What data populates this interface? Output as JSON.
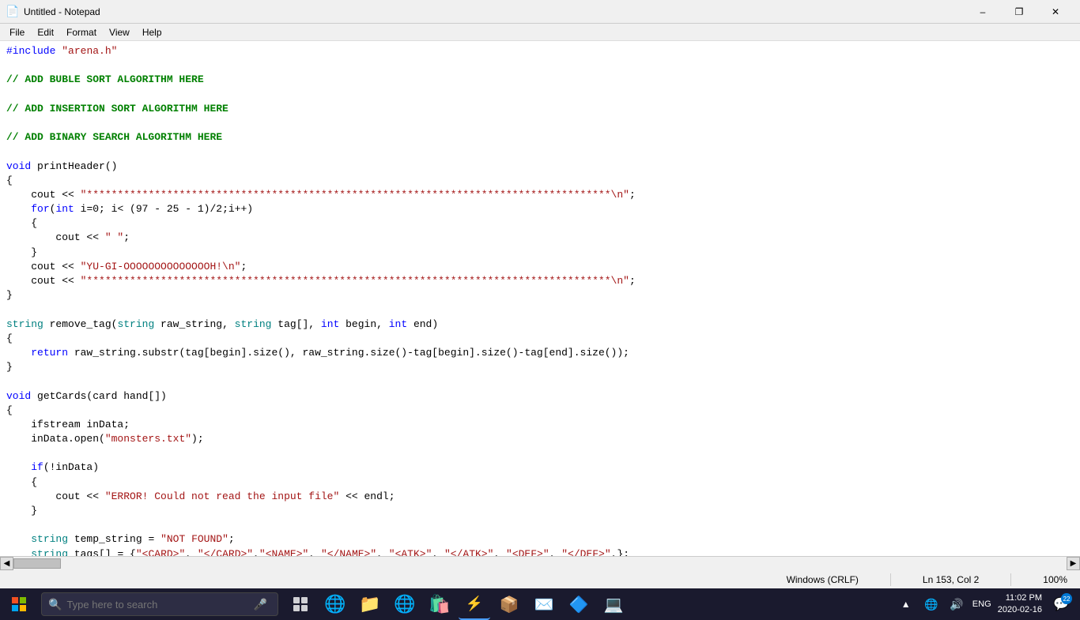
{
  "titlebar": {
    "icon": "📄",
    "title": "Untitled - Notepad",
    "minimize": "–",
    "maximize": "❐",
    "close": "✕"
  },
  "menu": {
    "items": [
      "File",
      "Edit",
      "Format",
      "View",
      "Help"
    ]
  },
  "code": {
    "lines": [
      "#include \"arena.h\"",
      "",
      "// ADD BUBLE SORT ALGORITHM HERE",
      "",
      "// ADD INSERTION SORT ALGORITHM HERE",
      "",
      "// ADD BINARY SEARCH ALGORITHM HERE",
      "",
      "void printHeader()",
      "{",
      "    cout << \"*************************************************************************************\\n\";",
      "    for(int i=0; i< (97 - 25 - 1)/2;i++)",
      "    {",
      "        cout << \" \";",
      "    }",
      "    cout << \"YU-GI-OOOOOOOOOOOOOOH!\\n\";",
      "    cout << \"*************************************************************************************\\n\";",
      "}",
      "",
      "string remove_tag(string raw_string, string tag[], int begin, int end)",
      "{",
      "    return raw_string.substr(tag[begin].size(), raw_string.size()-tag[begin].size()-tag[end].size());",
      "}",
      "",
      "void getCards(card hand[])",
      "{",
      "    ifstream inData;",
      "    inData.open(\"monsters.txt\");",
      "",
      "    if(!inData)",
      "    {",
      "        cout << \"ERROR! Could not read the input file\" << endl;",
      "    }",
      "",
      "    string temp_string = \"NOT FOUND\";",
      "    string tags[] = {\"<CARD>\", \"</CARD>\",\"<NAME>\", \"</NAME>\", \"<ATK>\", \"</ATK>\", \"<DEF>\", \"</DEF>\",};"
    ]
  },
  "statusbar": {
    "encoding": "Windows (CRLF)",
    "position": "Ln 153, Col 2",
    "zoom": "100%"
  },
  "taskbar": {
    "search_placeholder": "Type here to search",
    "clock_time": "11:02 PM",
    "clock_date": "2020-02-16",
    "language": "ENG",
    "notification_count": "22"
  }
}
